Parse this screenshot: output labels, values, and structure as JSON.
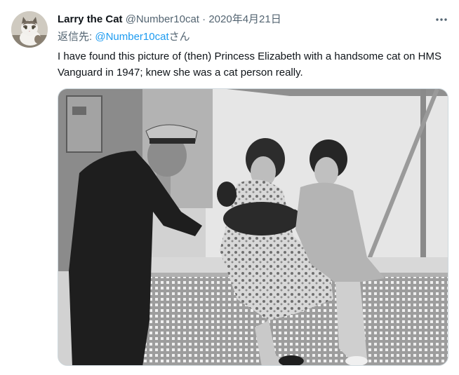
{
  "tweet": {
    "display_name": "Larry the Cat",
    "handle": "@Number10cat",
    "separator": "·",
    "date": "2020年4月21日",
    "replying_label": "返信先: ",
    "replying_mention": "@Number10cat",
    "replying_suffix": "さん",
    "text": "I have found this picture of (then) Princess Elizabeth with a handsome cat on HMS Vanguard in 1947; knew she was a cat person really."
  },
  "icons": {
    "more": "more-horizontal-icon",
    "avatar": "cat-avatar"
  },
  "colors": {
    "link": "#1d9bf0",
    "secondary_text": "#536471",
    "primary_text": "#0f1419"
  }
}
